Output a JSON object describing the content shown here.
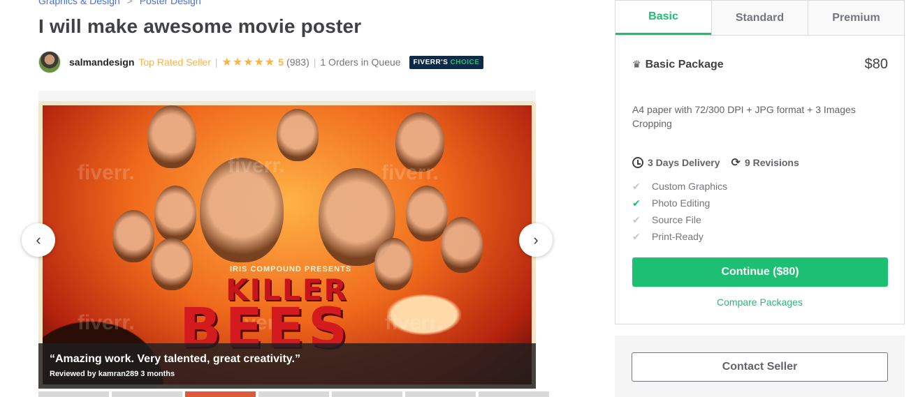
{
  "breadcrumb": {
    "items": [
      "Graphics & Design",
      "Poster Design"
    ],
    "separator": ">"
  },
  "gig": {
    "title": "I will make awesome movie poster"
  },
  "seller": {
    "name": "salmandesign",
    "level": "Top Rated Seller",
    "stars": "★★★★★",
    "rating": "5",
    "rating_count": "(983)",
    "queue": "1 Orders in Queue",
    "badge_prefix": "FIVERR'S",
    "badge_suffix": "CHOICE",
    "divider": "|"
  },
  "gallery": {
    "poster_presents": "IRIS COMPOUND PRESENTS",
    "poster_title_line1": "KILLER",
    "poster_title_line2": "BEES",
    "watermark": "fiverr.",
    "review_quote": "“Amazing work. Very talented, great creativity.”",
    "review_meta": "Reviewed by kamran289 3 months",
    "prev_icon": "‹",
    "next_icon": "›",
    "thumbnail_count": 7,
    "active_thumbnail": 3
  },
  "packages": {
    "tabs": [
      "Basic",
      "Standard",
      "Premium"
    ],
    "active_tab": "Basic",
    "name": "Basic Package",
    "price": "$80",
    "description": "A4 paper with 72/300 DPI + JPG format + 3 Images Cropping",
    "delivery": "3 Days Delivery",
    "revisions": "9 Revisions",
    "features": [
      {
        "label": "Custom Graphics",
        "included": false
      },
      {
        "label": "Photo Editing",
        "included": true
      },
      {
        "label": "Source File",
        "included": false
      },
      {
        "label": "Print-Ready",
        "included": false
      }
    ],
    "continue_label": "Continue ($80)",
    "compare_label": "Compare Packages"
  },
  "contact": {
    "label": "Contact Seller"
  },
  "colors": {
    "brand_green": "#1dbf73",
    "star_yellow": "#ffb33e",
    "link_blue": "#446ee7",
    "badge_navy": "#0e2a47"
  },
  "icons": [
    "crown-icon",
    "clock-icon",
    "refresh-icon",
    "check-icon",
    "chevron-left-icon",
    "chevron-right-icon"
  ]
}
